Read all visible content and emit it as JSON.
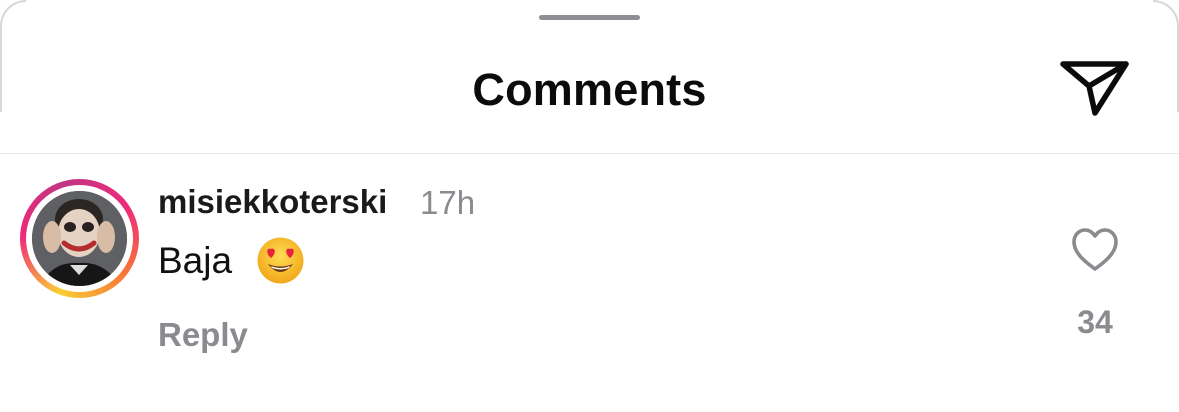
{
  "header": {
    "title": "Comments",
    "share_icon": "paper-plane-icon"
  },
  "comment": {
    "username": "misiekkoterski",
    "time": "17h",
    "text": "Baja",
    "emoji": "😍",
    "emoji_icon": "heart-eyes-emoji",
    "reply_label": "Reply",
    "like_icon": "heart-outline-icon",
    "like_count": "34",
    "story_ring": true
  },
  "colors": {
    "ring_gradient": [
      "#f9ce34",
      "#ee2a7b",
      "#c13584",
      "#f77737"
    ],
    "secondary_text": "#8a8a8f",
    "primary_text": "#111111"
  }
}
